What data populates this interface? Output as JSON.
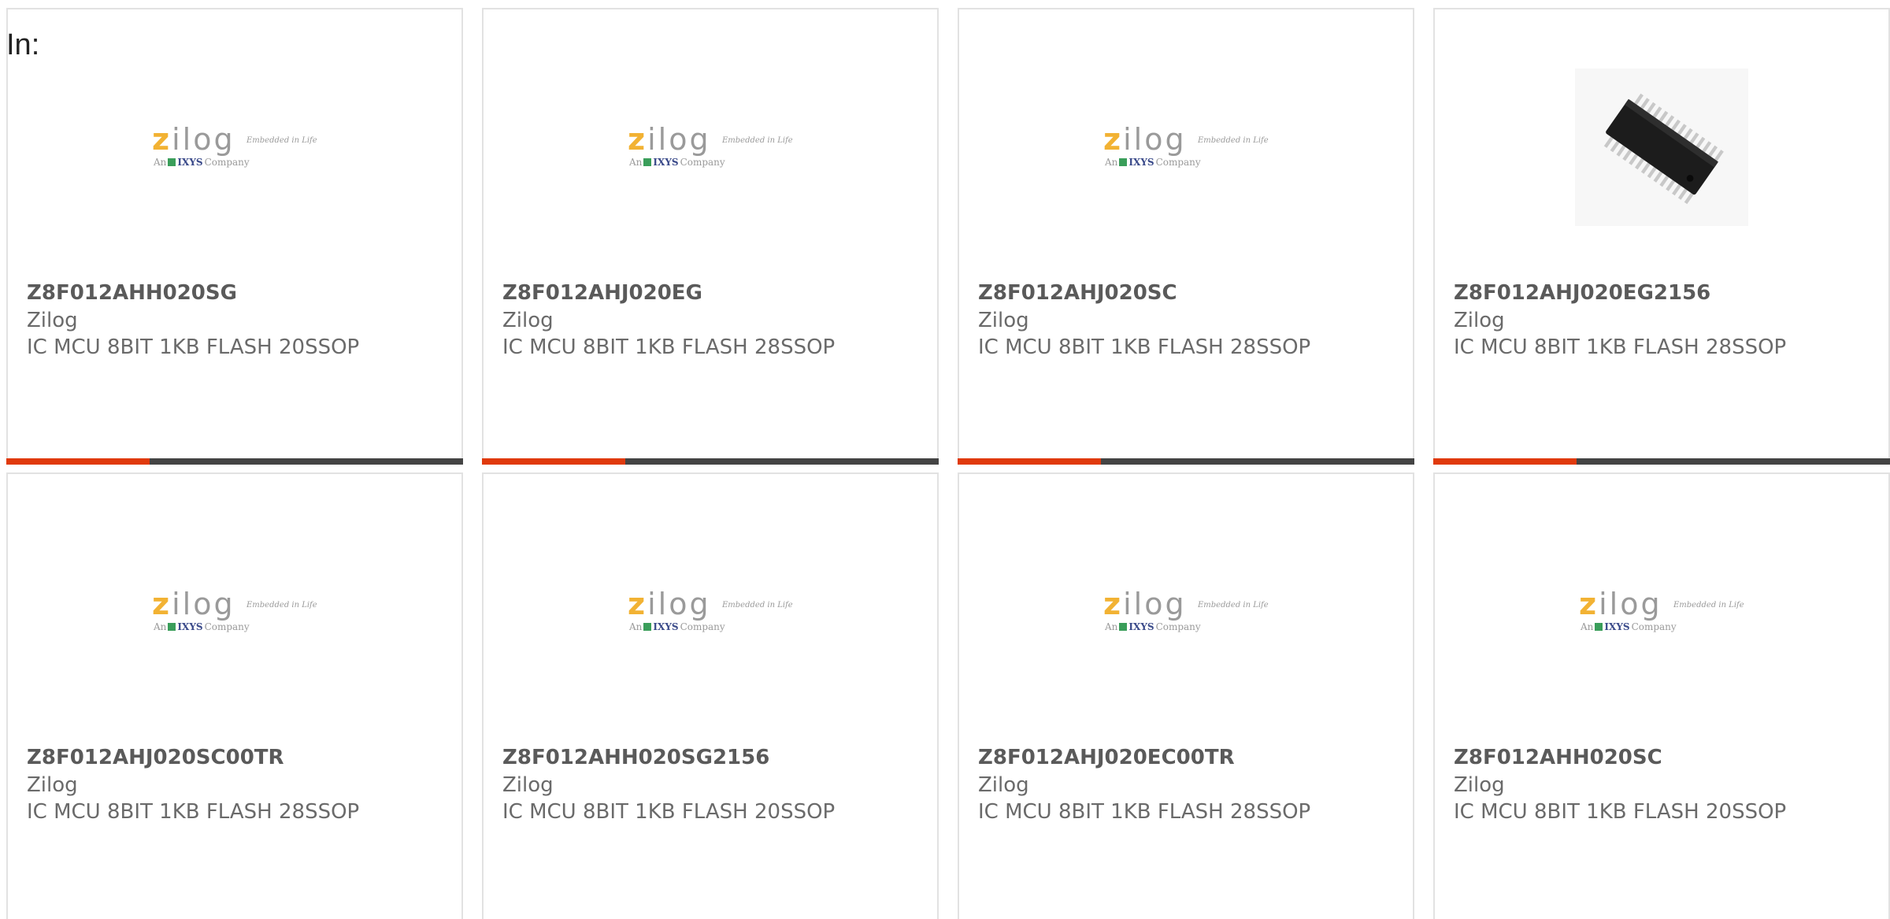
{
  "filter": {
    "label": "In:"
  },
  "colors": {
    "accent_bar": "#e03a0c",
    "dark_bar": "#444444",
    "logo_yellow": "#f2b233",
    "card_border": "#e2e2e2"
  },
  "logo": {
    "z": "z",
    "rest": "ilog",
    "tagline": "Embedded in Life",
    "prefix": "An",
    "ixys": "IXYS",
    "company": "Company"
  },
  "products": [
    {
      "part_number": "Z8F012AHH020SG",
      "manufacturer": "Zilog",
      "description": "IC MCU 8BIT 1KB FLASH 20SSOP",
      "image": "zilog-logo"
    },
    {
      "part_number": "Z8F012AHJ020EG",
      "manufacturer": "Zilog",
      "description": "IC MCU 8BIT 1KB FLASH 28SSOP",
      "image": "zilog-logo"
    },
    {
      "part_number": "Z8F012AHJ020SC",
      "manufacturer": "Zilog",
      "description": "IC MCU 8BIT 1KB FLASH 28SSOP",
      "image": "zilog-logo"
    },
    {
      "part_number": "Z8F012AHJ020EG2156",
      "manufacturer": "Zilog",
      "description": "IC MCU 8BIT 1KB FLASH 28SSOP",
      "image": "ic-chip-photo"
    },
    {
      "part_number": "Z8F012AHJ020SC00TR",
      "manufacturer": "Zilog",
      "description": "IC MCU 8BIT 1KB FLASH 28SSOP",
      "image": "zilog-logo"
    },
    {
      "part_number": "Z8F012AHH020SG2156",
      "manufacturer": "Zilog",
      "description": "IC MCU 8BIT 1KB FLASH 20SSOP",
      "image": "zilog-logo"
    },
    {
      "part_number": "Z8F012AHJ020EC00TR",
      "manufacturer": "Zilog",
      "description": "IC MCU 8BIT 1KB FLASH 28SSOP",
      "image": "zilog-logo"
    },
    {
      "part_number": "Z8F012AHH020SC",
      "manufacturer": "Zilog",
      "description": "IC MCU 8BIT 1KB FLASH 20SSOP",
      "image": "zilog-logo"
    }
  ]
}
